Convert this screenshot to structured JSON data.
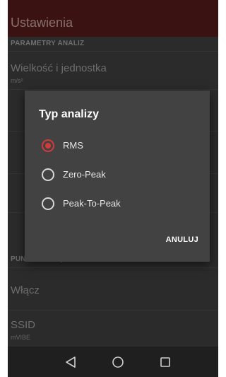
{
  "app": {
    "title": "Ustawienia"
  },
  "settings": {
    "section_analysis": "PARAMETRY ANALIZ",
    "quantity": {
      "title": "Wielkość i jednostka",
      "value": "m/s²"
    },
    "section_access_point": "PUNKT DOSTĘPOWY",
    "enable": {
      "title": "Włącz"
    },
    "ssid": {
      "title": "SSID",
      "value": "mVIBE"
    }
  },
  "dialog": {
    "title": "Typ analizy",
    "options": [
      {
        "label": "RMS",
        "selected": true
      },
      {
        "label": "Zero-Peak",
        "selected": false
      },
      {
        "label": "Peak-To-Peak",
        "selected": false
      }
    ],
    "cancel_label": "ANULUJ"
  },
  "navbar": {
    "back_icon": "back-triangle-icon",
    "home_icon": "home-circle-icon",
    "recents_icon": "recents-square-icon"
  },
  "colors": {
    "accent": "#d33a3a",
    "appbar": "#3a1212",
    "dialog_bg": "#424242",
    "background": "#2b2b2b"
  }
}
